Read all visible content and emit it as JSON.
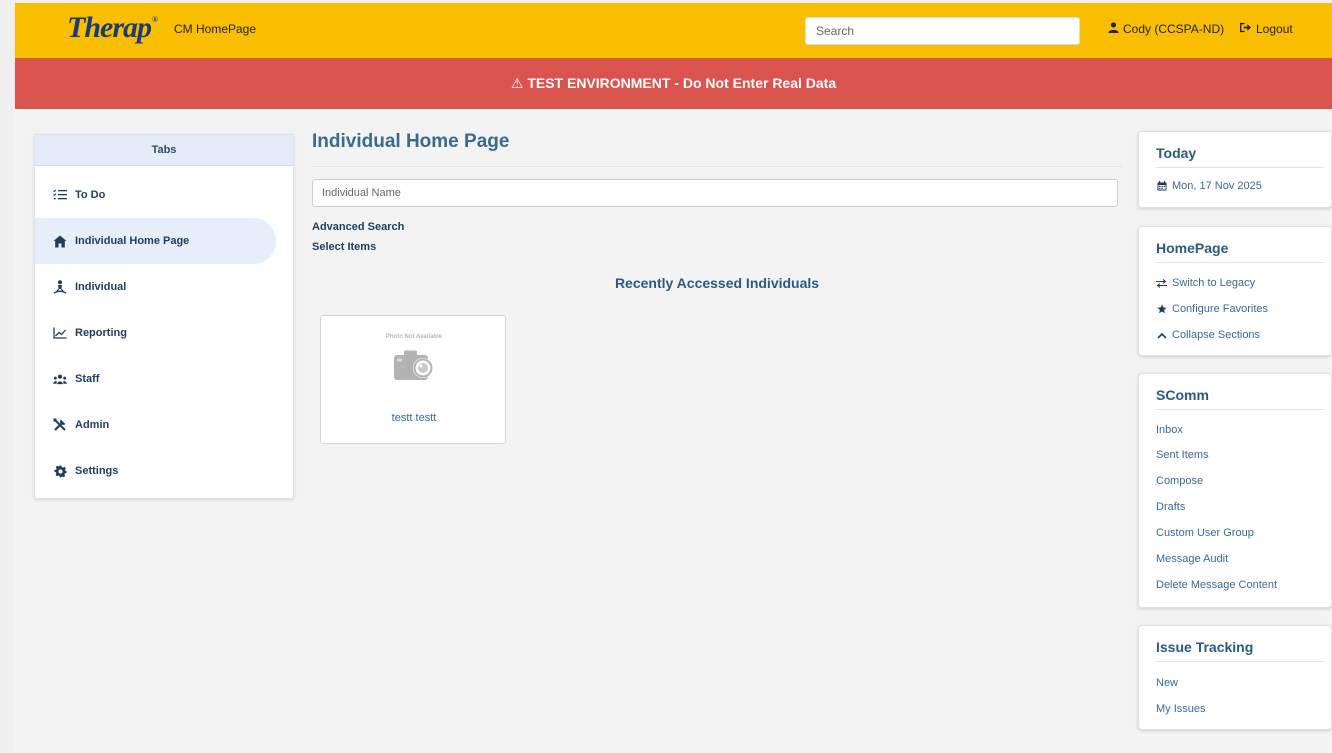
{
  "header": {
    "logo_text": "Therap",
    "logo_mark": "®",
    "app_name": "CM HomePage",
    "search_placeholder": "Search",
    "user_label": "Cody (CCSPA-ND)",
    "logout_label": "Logout",
    "brand_color": "#f9be00"
  },
  "banner": {
    "icon": "warning-triangle-icon",
    "text": "⚠ TEST ENVIRONMENT - Do Not Enter Real Data",
    "color": "#d9534f"
  },
  "tabs": {
    "header": "Tabs",
    "items": [
      {
        "label": "To Do",
        "icon": "checklist-icon",
        "active": false
      },
      {
        "label": "Individual Home Page",
        "icon": "home-icon",
        "active": true
      },
      {
        "label": "Individual",
        "icon": "person-icon",
        "active": false
      },
      {
        "label": "Reporting",
        "icon": "chart-line-icon",
        "active": false
      },
      {
        "label": "Staff",
        "icon": "users-icon",
        "active": false
      },
      {
        "label": "Admin",
        "icon": "tools-icon",
        "active": false
      },
      {
        "label": "Settings",
        "icon": "gear-icon",
        "active": false
      }
    ]
  },
  "main": {
    "title": "Individual Home Page",
    "name_placeholder": "Individual Name",
    "advanced_search": "Advanced Search",
    "select_items": "Select Items",
    "recent_title": "Recently Accessed Individuals",
    "recent_individuals": [
      {
        "photo_text": "Photo Not Available",
        "name": "testt testt"
      }
    ]
  },
  "widgets": {
    "today": {
      "title": "Today",
      "date": "Mon, 17 Nov 2025"
    },
    "homepage": {
      "title": "HomePage",
      "links": [
        "Switch to Legacy",
        "Configure Favorites",
        "Collapse Sections"
      ]
    },
    "scomm": {
      "title": "SComm",
      "links": [
        "Inbox",
        "Sent Items",
        "Compose",
        "Drafts",
        "Custom User Group",
        "Message Audit",
        "Delete Message Content"
      ]
    },
    "issue_tracking": {
      "title": "Issue Tracking",
      "links": [
        "New",
        "My Issues"
      ]
    }
  }
}
